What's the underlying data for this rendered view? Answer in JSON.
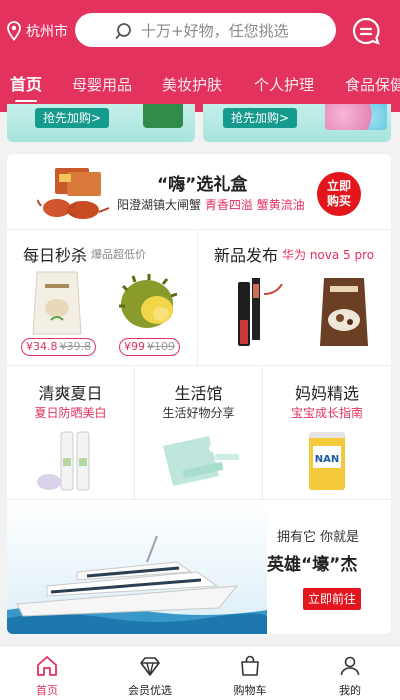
{
  "header": {
    "location": "杭州市",
    "search_placeholder": "十万+好物，任您挑选",
    "tabs": [
      {
        "label": "首页",
        "active": true
      },
      {
        "label": "母婴用品"
      },
      {
        "label": "美妆护肤"
      },
      {
        "label": "个人护理"
      },
      {
        "label": "食品保健"
      }
    ]
  },
  "banner_strip": {
    "left_button": "抢先加购>",
    "right_button": "抢先加购>"
  },
  "gift": {
    "title": "“嗨”选礼盒",
    "subtitle_main": "阳澄湖镇大闸蟹",
    "subtitle_highlight": "青香四溢 蟹黄流油",
    "cta": "立即购买"
  },
  "flash_sale": {
    "title": "每日秒杀",
    "subtitle": "爆品超低价",
    "items": [
      {
        "price": "¥34.8",
        "original": "¥39.8"
      },
      {
        "price": "¥99",
        "original": "¥109"
      }
    ]
  },
  "new_products": {
    "title": "新品发布",
    "subtitle": "华为 nova 5 pro"
  },
  "categories": [
    {
      "title": "清爽夏日",
      "subtitle": "夏日防晒美白"
    },
    {
      "title": "生活馆",
      "subtitle": "生活好物分享"
    },
    {
      "title": "妈妈精选",
      "subtitle": "宝宝成长指南"
    }
  ],
  "promo": {
    "line1": "拥有它 你就是",
    "line2": "英雄“壕”杰",
    "button": "立即前往"
  },
  "bottom_nav": [
    {
      "label": "首页",
      "icon": "home-icon",
      "active": true
    },
    {
      "label": "会员优选",
      "icon": "diamond-icon"
    },
    {
      "label": "购物车",
      "icon": "cart-bag-icon"
    },
    {
      "label": "我的",
      "icon": "user-icon"
    }
  ],
  "colors": {
    "brand": "#e2325d",
    "cta_red": "#e3161d",
    "teal": "#159a8e"
  }
}
